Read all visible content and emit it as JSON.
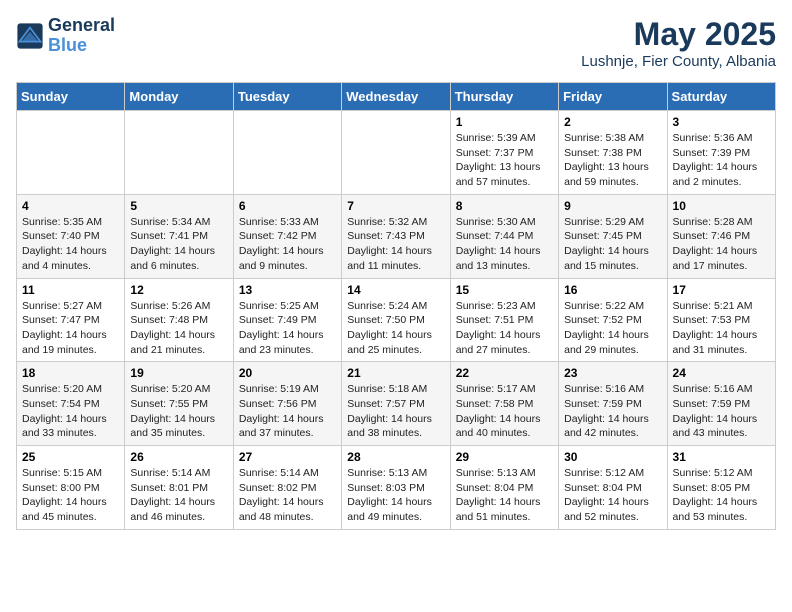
{
  "logo": {
    "general": "General",
    "blue": "Blue"
  },
  "title": "May 2025",
  "subtitle": "Lushnje, Fier County, Albania",
  "days_header": [
    "Sunday",
    "Monday",
    "Tuesday",
    "Wednesday",
    "Thursday",
    "Friday",
    "Saturday"
  ],
  "weeks": [
    [
      {
        "day": "",
        "info": ""
      },
      {
        "day": "",
        "info": ""
      },
      {
        "day": "",
        "info": ""
      },
      {
        "day": "",
        "info": ""
      },
      {
        "day": "1",
        "sunrise": "Sunrise: 5:39 AM",
        "sunset": "Sunset: 7:37 PM",
        "daylight": "Daylight: 13 hours and 57 minutes."
      },
      {
        "day": "2",
        "sunrise": "Sunrise: 5:38 AM",
        "sunset": "Sunset: 7:38 PM",
        "daylight": "Daylight: 13 hours and 59 minutes."
      },
      {
        "day": "3",
        "sunrise": "Sunrise: 5:36 AM",
        "sunset": "Sunset: 7:39 PM",
        "daylight": "Daylight: 14 hours and 2 minutes."
      }
    ],
    [
      {
        "day": "4",
        "sunrise": "Sunrise: 5:35 AM",
        "sunset": "Sunset: 7:40 PM",
        "daylight": "Daylight: 14 hours and 4 minutes."
      },
      {
        "day": "5",
        "sunrise": "Sunrise: 5:34 AM",
        "sunset": "Sunset: 7:41 PM",
        "daylight": "Daylight: 14 hours and 6 minutes."
      },
      {
        "day": "6",
        "sunrise": "Sunrise: 5:33 AM",
        "sunset": "Sunset: 7:42 PM",
        "daylight": "Daylight: 14 hours and 9 minutes."
      },
      {
        "day": "7",
        "sunrise": "Sunrise: 5:32 AM",
        "sunset": "Sunset: 7:43 PM",
        "daylight": "Daylight: 14 hours and 11 minutes."
      },
      {
        "day": "8",
        "sunrise": "Sunrise: 5:30 AM",
        "sunset": "Sunset: 7:44 PM",
        "daylight": "Daylight: 14 hours and 13 minutes."
      },
      {
        "day": "9",
        "sunrise": "Sunrise: 5:29 AM",
        "sunset": "Sunset: 7:45 PM",
        "daylight": "Daylight: 14 hours and 15 minutes."
      },
      {
        "day": "10",
        "sunrise": "Sunrise: 5:28 AM",
        "sunset": "Sunset: 7:46 PM",
        "daylight": "Daylight: 14 hours and 17 minutes."
      }
    ],
    [
      {
        "day": "11",
        "sunrise": "Sunrise: 5:27 AM",
        "sunset": "Sunset: 7:47 PM",
        "daylight": "Daylight: 14 hours and 19 minutes."
      },
      {
        "day": "12",
        "sunrise": "Sunrise: 5:26 AM",
        "sunset": "Sunset: 7:48 PM",
        "daylight": "Daylight: 14 hours and 21 minutes."
      },
      {
        "day": "13",
        "sunrise": "Sunrise: 5:25 AM",
        "sunset": "Sunset: 7:49 PM",
        "daylight": "Daylight: 14 hours and 23 minutes."
      },
      {
        "day": "14",
        "sunrise": "Sunrise: 5:24 AM",
        "sunset": "Sunset: 7:50 PM",
        "daylight": "Daylight: 14 hours and 25 minutes."
      },
      {
        "day": "15",
        "sunrise": "Sunrise: 5:23 AM",
        "sunset": "Sunset: 7:51 PM",
        "daylight": "Daylight: 14 hours and 27 minutes."
      },
      {
        "day": "16",
        "sunrise": "Sunrise: 5:22 AM",
        "sunset": "Sunset: 7:52 PM",
        "daylight": "Daylight: 14 hours and 29 minutes."
      },
      {
        "day": "17",
        "sunrise": "Sunrise: 5:21 AM",
        "sunset": "Sunset: 7:53 PM",
        "daylight": "Daylight: 14 hours and 31 minutes."
      }
    ],
    [
      {
        "day": "18",
        "sunrise": "Sunrise: 5:20 AM",
        "sunset": "Sunset: 7:54 PM",
        "daylight": "Daylight: 14 hours and 33 minutes."
      },
      {
        "day": "19",
        "sunrise": "Sunrise: 5:20 AM",
        "sunset": "Sunset: 7:55 PM",
        "daylight": "Daylight: 14 hours and 35 minutes."
      },
      {
        "day": "20",
        "sunrise": "Sunrise: 5:19 AM",
        "sunset": "Sunset: 7:56 PM",
        "daylight": "Daylight: 14 hours and 37 minutes."
      },
      {
        "day": "21",
        "sunrise": "Sunrise: 5:18 AM",
        "sunset": "Sunset: 7:57 PM",
        "daylight": "Daylight: 14 hours and 38 minutes."
      },
      {
        "day": "22",
        "sunrise": "Sunrise: 5:17 AM",
        "sunset": "Sunset: 7:58 PM",
        "daylight": "Daylight: 14 hours and 40 minutes."
      },
      {
        "day": "23",
        "sunrise": "Sunrise: 5:16 AM",
        "sunset": "Sunset: 7:59 PM",
        "daylight": "Daylight: 14 hours and 42 minutes."
      },
      {
        "day": "24",
        "sunrise": "Sunrise: 5:16 AM",
        "sunset": "Sunset: 7:59 PM",
        "daylight": "Daylight: 14 hours and 43 minutes."
      }
    ],
    [
      {
        "day": "25",
        "sunrise": "Sunrise: 5:15 AM",
        "sunset": "Sunset: 8:00 PM",
        "daylight": "Daylight: 14 hours and 45 minutes."
      },
      {
        "day": "26",
        "sunrise": "Sunrise: 5:14 AM",
        "sunset": "Sunset: 8:01 PM",
        "daylight": "Daylight: 14 hours and 46 minutes."
      },
      {
        "day": "27",
        "sunrise": "Sunrise: 5:14 AM",
        "sunset": "Sunset: 8:02 PM",
        "daylight": "Daylight: 14 hours and 48 minutes."
      },
      {
        "day": "28",
        "sunrise": "Sunrise: 5:13 AM",
        "sunset": "Sunset: 8:03 PM",
        "daylight": "Daylight: 14 hours and 49 minutes."
      },
      {
        "day": "29",
        "sunrise": "Sunrise: 5:13 AM",
        "sunset": "Sunset: 8:04 PM",
        "daylight": "Daylight: 14 hours and 51 minutes."
      },
      {
        "day": "30",
        "sunrise": "Sunrise: 5:12 AM",
        "sunset": "Sunset: 8:04 PM",
        "daylight": "Daylight: 14 hours and 52 minutes."
      },
      {
        "day": "31",
        "sunrise": "Sunrise: 5:12 AM",
        "sunset": "Sunset: 8:05 PM",
        "daylight": "Daylight: 14 hours and 53 minutes."
      }
    ]
  ]
}
